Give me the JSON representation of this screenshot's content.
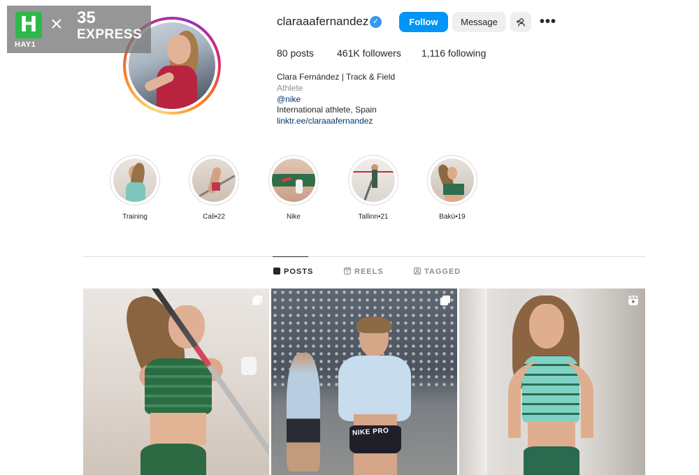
{
  "watermark": {
    "h_letter": "H",
    "hay": "HAY1",
    "times": "×",
    "number": "35",
    "express": "EXPRESS"
  },
  "profile": {
    "username": "claraaafernandez",
    "verified_glyph": "✓",
    "buttons": {
      "follow": "Follow",
      "message": "Message",
      "add_user": "+2",
      "more": "•••"
    },
    "stats": {
      "posts": "80",
      "posts_label": "posts",
      "followers": "461K",
      "followers_label": "followers",
      "following": "1,116",
      "following_label": "following"
    },
    "bio": {
      "name": "Clara Fernández | Track & Field",
      "category": "Athlete",
      "mention": "@nike",
      "text": "International athlete, Spain",
      "link": "linktr.ee/claraaafernandez"
    }
  },
  "highlights": [
    {
      "label": "Training"
    },
    {
      "label": "Cali•22"
    },
    {
      "label": "Nike"
    },
    {
      "label": "Tallinn•21"
    },
    {
      "label": "Bakú•19"
    }
  ],
  "tabs": {
    "posts": "POSTS",
    "reels": "REELS",
    "tagged": "TAGGED"
  },
  "posts": [
    {
      "type": "carousel",
      "brand_text": ""
    },
    {
      "type": "carousel",
      "brand_text": "NIKE PRO"
    },
    {
      "type": "reel",
      "brand_text": ""
    }
  ],
  "colors": {
    "accent": "#0095f6",
    "verified": "#3897f0",
    "link": "#00376b",
    "muted": "#8e8e8e"
  }
}
